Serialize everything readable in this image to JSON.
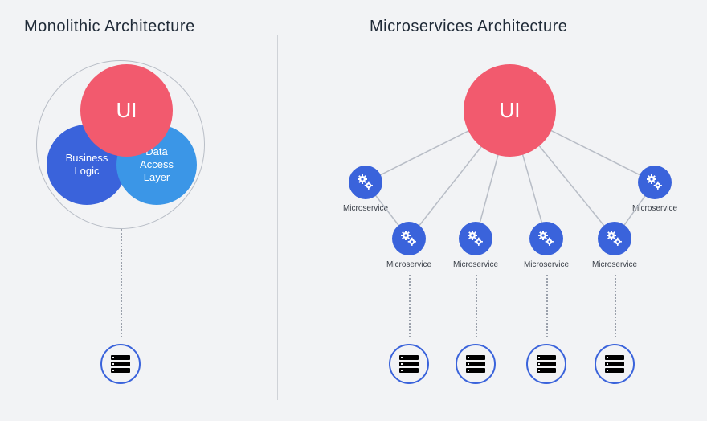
{
  "left": {
    "title": "Monolithic Architecture",
    "ui": "UI",
    "business": "Business\nLogic",
    "data": "Data\nAccess\nLayer"
  },
  "right": {
    "title": "Microservices Architecture",
    "ui": "UI",
    "ms_label": "Microservice"
  },
  "colors": {
    "accent_red": "#f25a6e",
    "accent_blue": "#3a63db",
    "accent_lightblue": "#3b96e7"
  }
}
